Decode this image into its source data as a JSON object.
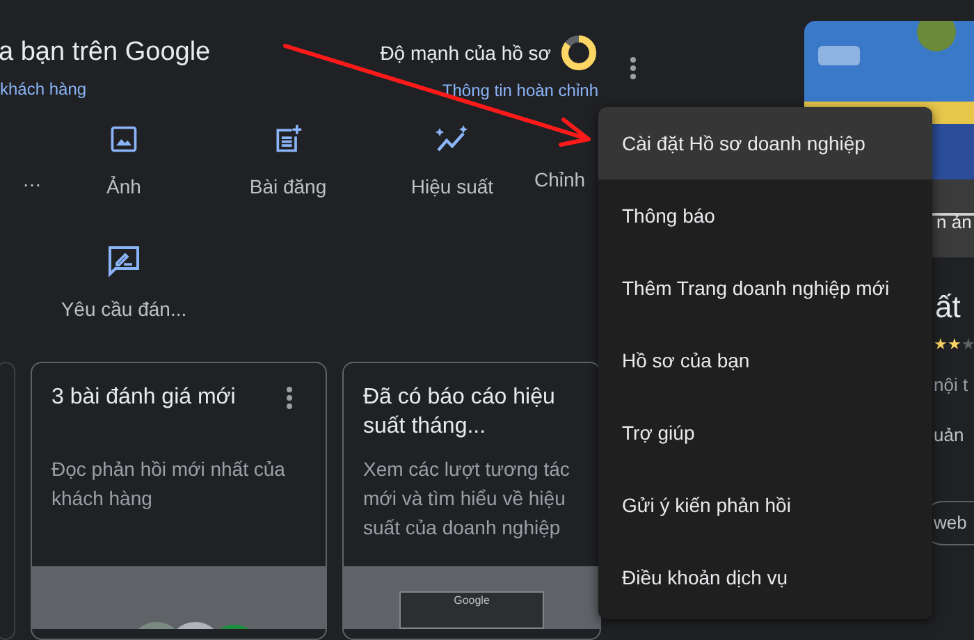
{
  "header": {
    "title": "a bạn trên Google",
    "subtitle_link": "khách hàng"
  },
  "strength": {
    "label": "Độ mạnh của hồ sơ",
    "level": 0.85,
    "link": "Thông tin hoàn chỉnh"
  },
  "actions": [
    {
      "kind": "none",
      "label": "…"
    },
    {
      "label": "Ảnh"
    },
    {
      "kind": "post",
      "label": "Bài đăng"
    },
    {
      "kind": "performance",
      "label": "Hiệu suất"
    },
    {
      "kind": "none",
      "label": "Chỉnh"
    },
    {
      "kind": "review",
      "label": "Yêu cầu đán..."
    }
  ],
  "cards": [
    {
      "title": "3 bài đánh giá mới",
      "body": "Đọc phản hồi mới nhất của khách hàng",
      "kind": "reviews"
    },
    {
      "title": "Đã có báo cáo hiệu suất tháng...",
      "body": "Xem các lượt tương tác mới và tìm hiểu về hiệu suất của doanh nghiệp",
      "kind": "report",
      "preview_label": "Google"
    }
  ],
  "menu": [
    {
      "label": "Cài đặt Hồ sơ doanh nghiệp",
      "selected": true
    },
    {
      "label": "Thông báo",
      "selected": false
    },
    {
      "label": "Thêm Trang doanh nghiệp mới",
      "selected": false
    },
    {
      "label": "Hồ sơ của bạn",
      "selected": false
    },
    {
      "label": "Trợ giúp",
      "selected": false
    },
    {
      "label": "Gửi ý kiến phản hồi",
      "selected": false
    },
    {
      "label": "Điều khoản dịch vụ",
      "selected": false
    }
  ],
  "knowledge_panel": {
    "photo_caption": "n ản",
    "title": "ất",
    "stars": 2,
    "line_1": "nội t",
    "line_2": "uản",
    "chip": "web"
  }
}
